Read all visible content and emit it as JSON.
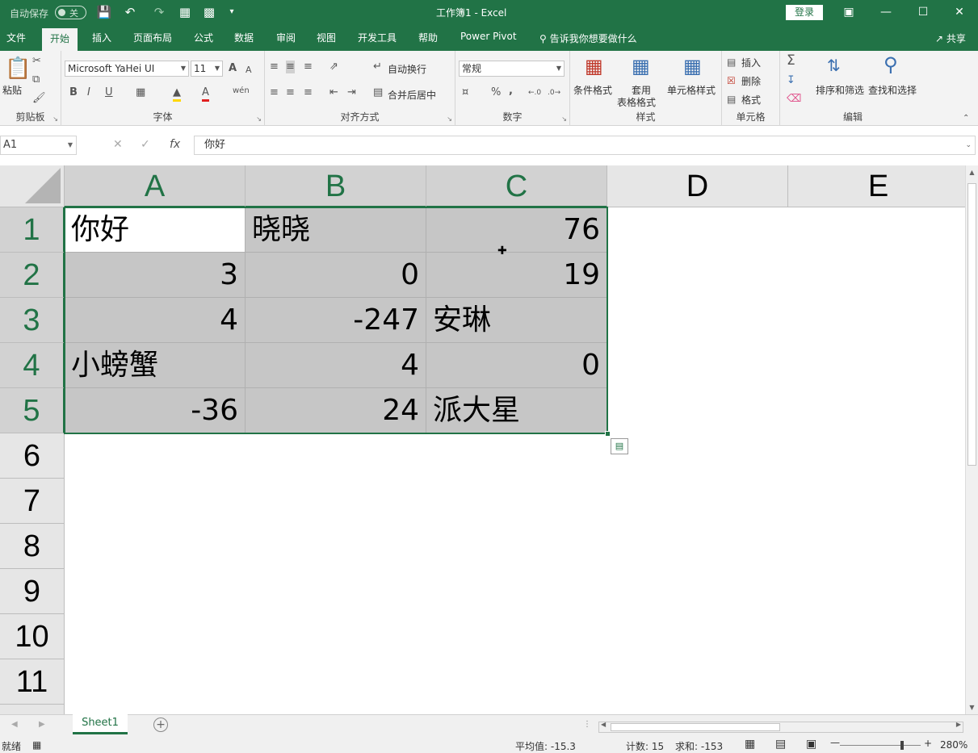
{
  "titlebar": {
    "autosave_label": "自动保存",
    "autosave_state": "关",
    "document_title": "工作簿1  -  Excel",
    "login_label": "登录",
    "quick_access_icons": [
      "save-icon",
      "undo-icon",
      "redo-icon",
      "chart-icon",
      "image-icon",
      "customize-icon"
    ]
  },
  "tabs": [
    {
      "label": "文件"
    },
    {
      "label": "开始"
    },
    {
      "label": "插入"
    },
    {
      "label": "页面布局"
    },
    {
      "label": "公式"
    },
    {
      "label": "数据"
    },
    {
      "label": "审阅"
    },
    {
      "label": "视图"
    },
    {
      "label": "开发工具"
    },
    {
      "label": "帮助"
    },
    {
      "label": "Power Pivot"
    }
  ],
  "tell_me": "告诉我你想要做什么",
  "share_label": "共享",
  "ribbon": {
    "clipboard": {
      "paste_label": "粘贴",
      "group_label": "剪贴板"
    },
    "font": {
      "font_name": "Microsoft YaHei UI",
      "font_size": "11",
      "bold": "B",
      "italic": "I",
      "underline": "U",
      "grow": "A",
      "shrink": "A",
      "font_color": "A",
      "phonetic": "wén",
      "group_label": "字体"
    },
    "alignment": {
      "wrap_label": "自动换行",
      "merge_label": "合并后居中",
      "group_label": "对齐方式"
    },
    "number": {
      "format": "常规",
      "percent": "%",
      "comma": ",",
      "group_label": "数字"
    },
    "styles": {
      "conditional_label": "条件格式",
      "table_label_1": "套用",
      "table_label_2": "表格格式",
      "cell_styles_label": "单元格样式",
      "group_label": "样式"
    },
    "cells": {
      "insert_label": "插入",
      "delete_label": "删除",
      "format_label": "格式",
      "group_label": "单元格"
    },
    "editing": {
      "sum_symbol": "Σ",
      "sort_label": "排序和筛选",
      "find_label": "查找和选择",
      "group_label": "编辑"
    }
  },
  "formula_bar": {
    "name_box": "A1",
    "cancel": "✕",
    "enter": "✓",
    "fx": "fx",
    "content": "你好"
  },
  "sheet": {
    "columns": [
      "A",
      "B",
      "C",
      "D",
      "E"
    ],
    "rows": [
      "1",
      "2",
      "3",
      "4",
      "5",
      "6",
      "7",
      "8",
      "9",
      "10",
      "11"
    ],
    "cells": [
      [
        "你好",
        "晓晓",
        "76"
      ],
      [
        "3",
        "0",
        "19"
      ],
      [
        "4",
        "-247",
        "安琳"
      ],
      [
        "小螃蟹",
        "4",
        "0"
      ],
      [
        "-36",
        "24",
        "派大星"
      ]
    ]
  },
  "sheet_tabs": [
    {
      "label": "Sheet1"
    }
  ],
  "status": {
    "ready": "就绪",
    "average": "平均值: -15.3",
    "count": "计数: 15",
    "sum": "求和: -153",
    "zoom": "280%"
  },
  "colors": {
    "accent": "#217346",
    "selection": "#c6c6c6",
    "header_bg": "#e6e6e6"
  }
}
